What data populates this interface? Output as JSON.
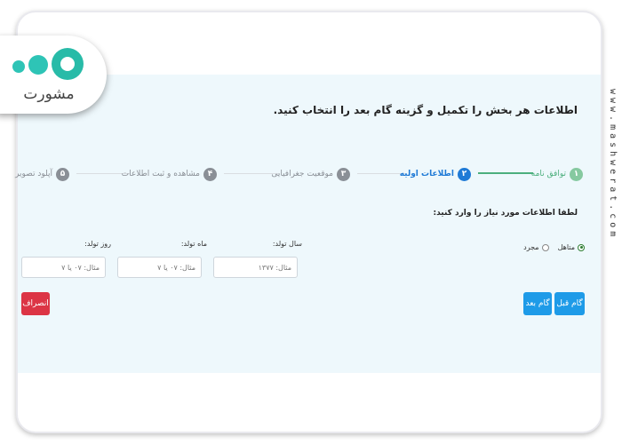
{
  "logo": {
    "text": "مشورت"
  },
  "watermark": "www.mashwerat.com",
  "heading": "اطلاعات هر بخش را تکمیل و گزینه گام بعد را انتخاب کنید.",
  "steps": [
    {
      "num": "۱",
      "label": "توافق نامه",
      "state": "done"
    },
    {
      "num": "۲",
      "label": "اطلاعات اولیه",
      "state": "active"
    },
    {
      "num": "۳",
      "label": "موقعیت جغرافیایی",
      "state": "pending"
    },
    {
      "num": "۴",
      "label": "مشاهده و ثبت اطلاعات",
      "state": "pending"
    },
    {
      "num": "۵",
      "label": "آپلود تصویر",
      "state": "pending"
    }
  ],
  "form": {
    "instruction": "لطفا اطلاعات مورد نیاز را وارد کنید:",
    "marital_options": [
      {
        "label": "متاهل",
        "selected": true
      },
      {
        "label": "مجرد",
        "selected": false
      }
    ],
    "birth_year": {
      "label": "سال تولد:",
      "placeholder": "مثال: ۱۳۷۷"
    },
    "birth_month": {
      "label": "ماه تولد:",
      "placeholder": "مثال: ۰۷ یا ۷"
    },
    "birth_day": {
      "label": "روز تولد:",
      "placeholder": "مثال: ۰۷ یا ۷"
    }
  },
  "buttons": {
    "prev": "گام قبل",
    "next": "گام بعد",
    "cancel": "انصراف"
  },
  "colors": {
    "done": "#86c9a0",
    "active": "#1f7ad6",
    "pending": "#8a8f96",
    "primary_btn": "#1e9be8",
    "cancel_btn": "#dc3545",
    "panel": "#eef8fc"
  }
}
